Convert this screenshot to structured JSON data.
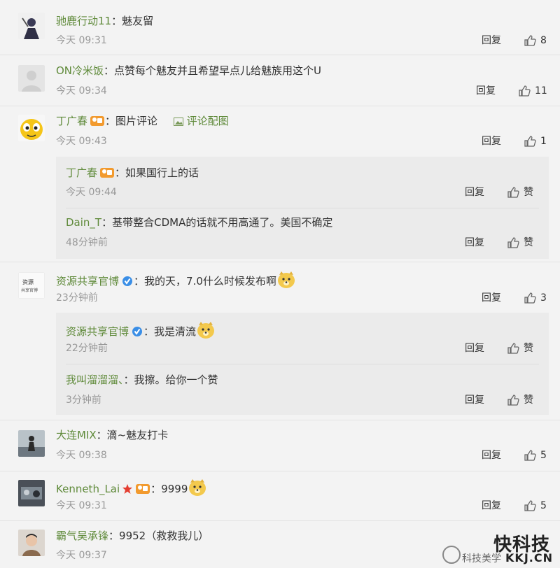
{
  "labels": {
    "reply": "回复",
    "like_word": "赞"
  },
  "comments": [
    {
      "user": "驰鹿行动11",
      "text": "魅友留",
      "time": "今天 09:31",
      "likes": "8"
    },
    {
      "user": "ON冷米饭",
      "text": "点赞每个魅友并且希望早点儿给魅族用这个U",
      "time": "今天 09:34",
      "likes": "11"
    },
    {
      "user": "丁广春",
      "text": "图片评论",
      "pic_link": "评论配图",
      "time": "今天 09:43",
      "likes": "1",
      "replies": [
        {
          "user": "丁广春",
          "text": "如果国行上的话",
          "time": "今天 09:44"
        },
        {
          "user": "Dain_T",
          "text": "基带整合CDMA的话就不用高通了。美国不确定",
          "time": "48分钟前"
        }
      ]
    },
    {
      "user": "资源共享官博",
      "text": "我的天，7.0什么时候发布啊",
      "time": "23分钟前",
      "likes": "3",
      "replies": [
        {
          "user": "资源共享官博",
          "text": "我是清流",
          "time": "22分钟前"
        },
        {
          "user": "我叫溜溜溜、",
          "text": "我擦。给你一个赞",
          "time": "3分钟前"
        }
      ]
    },
    {
      "user": "大连MIX",
      "text": "滴~魅友打卡",
      "time": "今天 09:38",
      "likes": "5"
    },
    {
      "user": "Kenneth_Lai",
      "text": "9999",
      "time": "今天 09:31",
      "likes": "5"
    },
    {
      "user": "霸气吴承锋",
      "text": "9952（救救我儿）",
      "time": "今天 09:37"
    }
  ],
  "watermark": {
    "brand": "快科技",
    "domain": "KKJ.CN",
    "account": "科技美学"
  },
  "colors": {
    "username": "#5f8a3a",
    "background": "#f3f3f3",
    "reply_box": "#ebebeb"
  }
}
